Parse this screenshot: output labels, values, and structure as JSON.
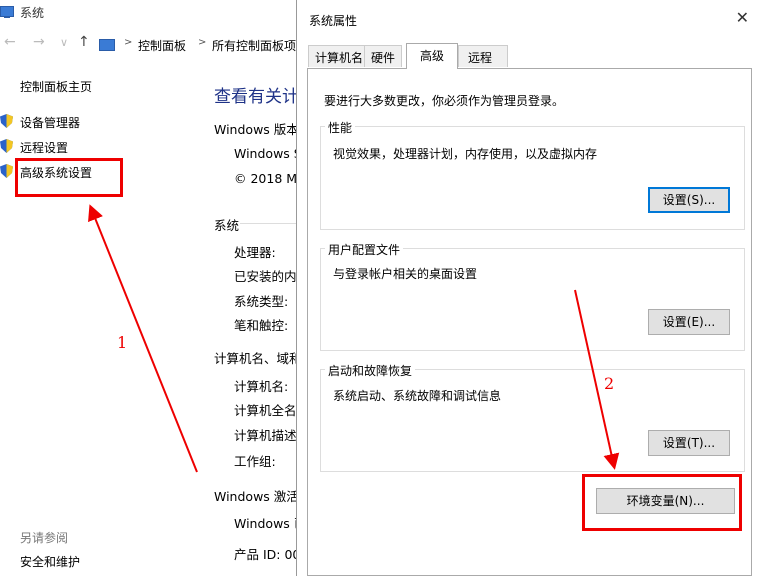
{
  "background_window": {
    "title": "系统",
    "breadcrumbs": [
      "控制面板",
      "所有控制面板项"
    ],
    "nav": {
      "back": "←",
      "forward": "→",
      "recent": "∨",
      "up": "↑",
      "sep": ">"
    },
    "sidebar": {
      "home": "控制面板主页",
      "items": [
        {
          "label": "设备管理器",
          "icon": "shield-icon"
        },
        {
          "label": "远程设置",
          "icon": "shield-icon"
        },
        {
          "label": "高级系统设置",
          "icon": "shield-icon"
        }
      ],
      "see_also_label": "另请参阅",
      "see_also_items": [
        "安全和维护"
      ]
    },
    "main": {
      "heading": "查看有关计",
      "windows_edition_label": "Windows 版本",
      "windows_name": "Windows S",
      "copyright": "© 2018 Mi",
      "system_section": "系统",
      "system_rows": [
        "处理器:",
        "已安装的内",
        "系统类型:",
        "笔和触控:"
      ],
      "computer_section": "计算机名、域和",
      "computer_rows": [
        "计算机名:",
        "计算机全名",
        "计算机描述",
        "工作组:"
      ],
      "activation_section": "Windows 激活",
      "activation_rows": [
        "Windows 已",
        "产品 ID: 00"
      ]
    }
  },
  "dialog": {
    "title": "系统属性",
    "close": "✕",
    "tabs": [
      "计算机名",
      "硬件",
      "高级",
      "远程"
    ],
    "active_tab": "高级",
    "admin_note": "要进行大多数更改，你必须作为管理员登录。",
    "groups": [
      {
        "label": "性能",
        "desc": "视觉效果，处理器计划，内存使用，以及虚拟内存",
        "button": "设置(S)..."
      },
      {
        "label": "用户配置文件",
        "desc": "与登录帐户相关的桌面设置",
        "button": "设置(E)..."
      },
      {
        "label": "启动和故障恢复",
        "desc": "系统启动、系统故障和调试信息",
        "button": "设置(T)..."
      }
    ],
    "env_button": "环境变量(N)..."
  },
  "annotations": {
    "step1": "1",
    "step2": "2",
    "color": "#e00000"
  }
}
